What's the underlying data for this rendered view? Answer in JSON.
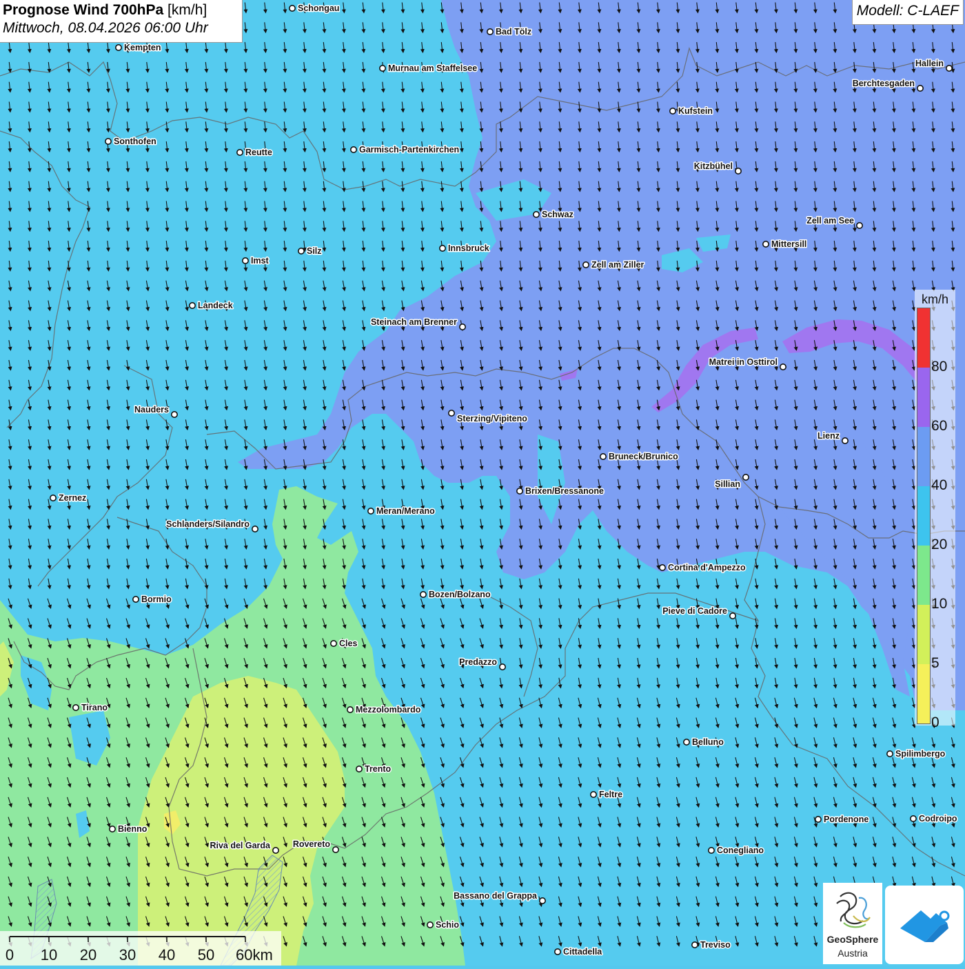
{
  "title": {
    "main": "Prognose Wind 700hPa",
    "unit": "[km/h]",
    "datetime": "Mittwoch, 08.04.2026 06:00 Uhr"
  },
  "model": "Modell: C-LAEF",
  "legend": {
    "unit": "km/h",
    "ticks": [
      "0",
      "5",
      "10",
      "20",
      "40",
      "60",
      "80"
    ],
    "bands": [
      {
        "from": 0,
        "to": 5,
        "color": "#f5f05a"
      },
      {
        "from": 5,
        "to": 10,
        "color": "#d2f05a"
      },
      {
        "from": 10,
        "to": 20,
        "color": "#7de88c"
      },
      {
        "from": 20,
        "to": 40,
        "color": "#3dc4ee"
      },
      {
        "from": 40,
        "to": 60,
        "color": "#6c9cf2"
      },
      {
        "from": 60,
        "to": 80,
        "color": "#9a66ee"
      },
      {
        "from": 80,
        "to": 100,
        "color": "#f03232"
      }
    ]
  },
  "scale_bar": {
    "ticks": [
      "0",
      "10",
      "20",
      "30",
      "40",
      "50",
      "60km"
    ]
  },
  "branding": {
    "logo_name_line1": "GeoSphere",
    "logo_name_line2": "Austria"
  },
  "cities": [
    {
      "name": "Schongau"
    },
    {
      "name": "Bad Tölz"
    },
    {
      "name": "Kempten"
    },
    {
      "name": "Murnau am Staffelsee"
    },
    {
      "name": "Hallein"
    },
    {
      "name": "Berchtesgaden"
    },
    {
      "name": "Kufstein"
    },
    {
      "name": "Sonthofen"
    },
    {
      "name": "Reutte"
    },
    {
      "name": "Garmisch-Partenkirchen"
    },
    {
      "name": "Kitzbühel"
    },
    {
      "name": "Schwaz"
    },
    {
      "name": "Zell am See"
    },
    {
      "name": "Mittersill"
    },
    {
      "name": "Innsbruck"
    },
    {
      "name": "Silz"
    },
    {
      "name": "Imst"
    },
    {
      "name": "Zell am Ziller"
    },
    {
      "name": "Landeck"
    },
    {
      "name": "Steinach am Brenner"
    },
    {
      "name": "Matrei in Osttirol"
    },
    {
      "name": "Nauders"
    },
    {
      "name": "Sterzing/Vipiteno"
    },
    {
      "name": "Lienz"
    },
    {
      "name": "Bruneck/Brunico"
    },
    {
      "name": "Sillian"
    },
    {
      "name": "Zernez"
    },
    {
      "name": "Brixen/Bressanone"
    },
    {
      "name": "Meran/Merano"
    },
    {
      "name": "Schlanders/Silandro"
    },
    {
      "name": "Cortina d'Ampezzo"
    },
    {
      "name": "Bozen/Bolzano"
    },
    {
      "name": "Bormio"
    },
    {
      "name": "Pieve di Cadore"
    },
    {
      "name": "Cles"
    },
    {
      "name": "Predazzo"
    },
    {
      "name": "Tirano"
    },
    {
      "name": "Mezzolombardo"
    },
    {
      "name": "Belluno"
    },
    {
      "name": "Spilimbergo"
    },
    {
      "name": "Trento"
    },
    {
      "name": "Feltre"
    },
    {
      "name": "Pordenone"
    },
    {
      "name": "Codroipo"
    },
    {
      "name": "Bienno"
    },
    {
      "name": "Riva del Garda"
    },
    {
      "name": "Rovereto"
    },
    {
      "name": "Conegliano"
    },
    {
      "name": "Bassano del Grappa"
    },
    {
      "name": "Schio"
    },
    {
      "name": "Treviso"
    },
    {
      "name": "Cittadella"
    }
  ]
}
